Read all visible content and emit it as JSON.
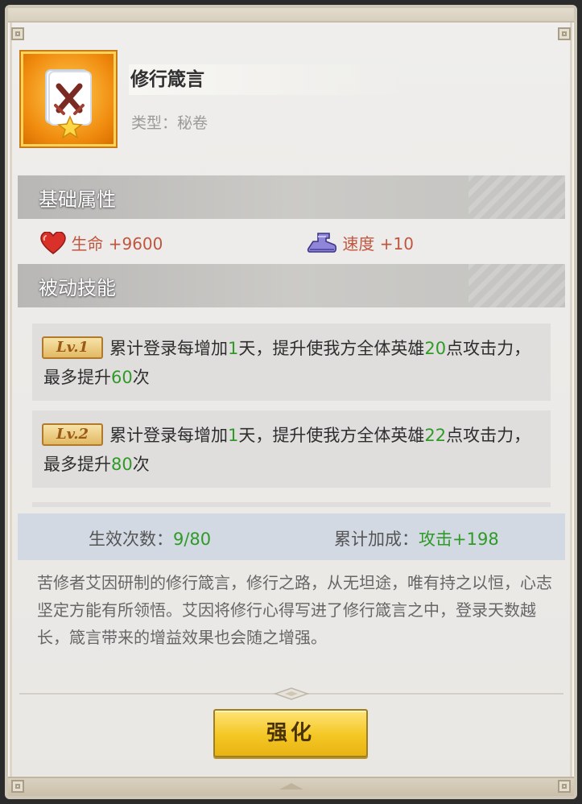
{
  "item": {
    "name": "修行箴言",
    "type": "类型：秘卷",
    "icon": "scroll-crossed-swords-icon"
  },
  "sections": {
    "base_stats": "基础属性",
    "passive_skill": "被动技能"
  },
  "stats": {
    "life": "生命 +9600",
    "speed": "速度 +10",
    "life_icon": "heart-icon",
    "speed_icon": "boot-icon"
  },
  "skills": [
    {
      "level": "Lv.1",
      "text_a": "累计登录每增加",
      "num_a": "1",
      "text_b": "天，提升使我方全体英雄",
      "num_b": "20",
      "text_c": "点攻击力，最多提升",
      "num_c": "60",
      "text_d": "次"
    },
    {
      "level": "Lv.2",
      "text_a": "累计登录每增加",
      "num_a": "1",
      "text_b": "天，提升使我方全体英雄",
      "num_b": "22",
      "text_c": "点攻击力，最多提升",
      "num_c": "80",
      "text_d": "次"
    }
  ],
  "effect": {
    "count_label": "生效次数：",
    "count_value": "9/80",
    "bonus_label": "累计加成：",
    "bonus_value": "攻击+198"
  },
  "description": "苦修者艾因研制的修行箴言，修行之路，从无坦途，唯有持之以恒，心志坚定方能有所领悟。艾因将修行心得写进了修行箴言之中，登录天数越长，箴言带来的增益效果也会随之增强。",
  "button": {
    "upgrade": "强化"
  },
  "colors": {
    "accent_green": "#2f9a27",
    "stat_red": "#c0563f",
    "button_yellow": "#f4c724",
    "icon_orange": "#f08b0e"
  }
}
